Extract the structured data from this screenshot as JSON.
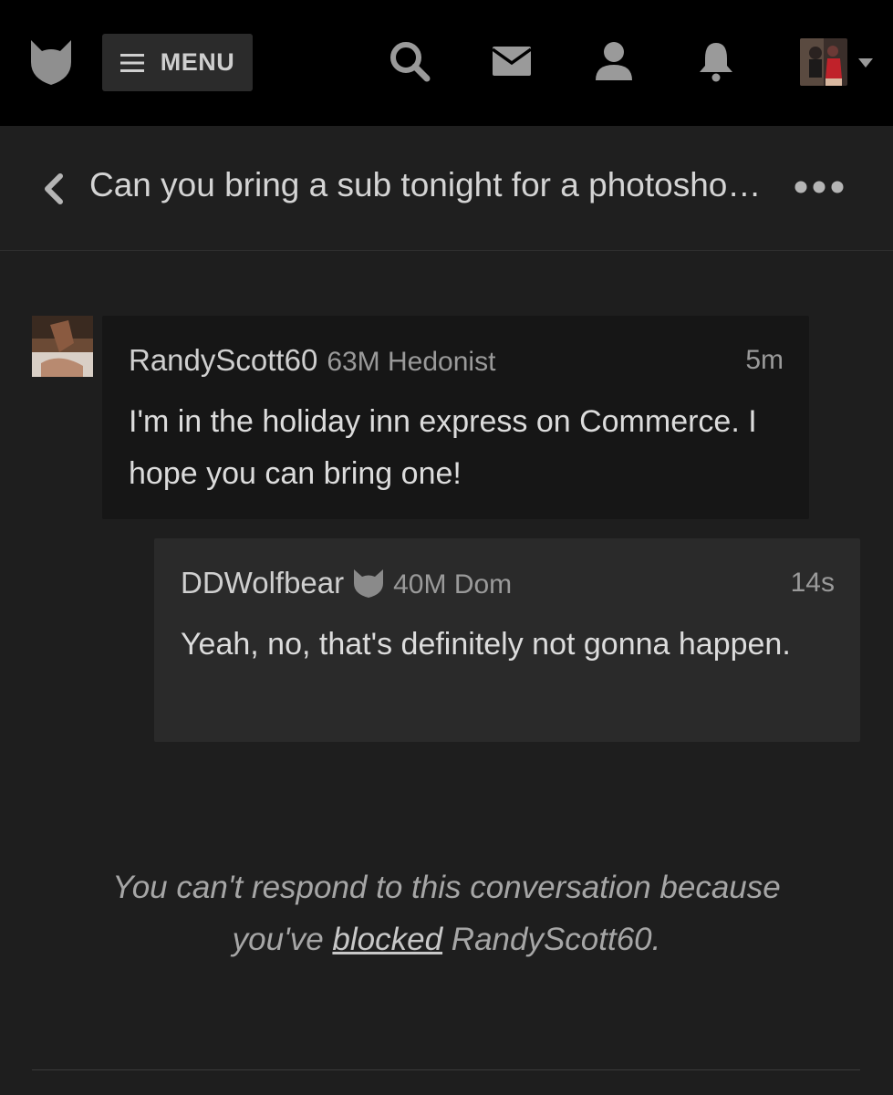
{
  "topbar": {
    "menu_label": "MENU",
    "icons": [
      "logo-icon",
      "hamburger-icon",
      "search-icon",
      "mail-icon",
      "user-icon",
      "bell-icon",
      "chevron-down-icon"
    ]
  },
  "conversation": {
    "title": "Can you bring a sub tonight for a photosho…"
  },
  "messages": [
    {
      "username": "RandyScott60",
      "details": "63M Hedonist",
      "time": "5m",
      "text": "I'm in the holiday inn express on Commerce. I hope you can bring one!"
    },
    {
      "username": "DDWolfbear",
      "details": "40M Dom",
      "time": "14s",
      "text": "Yeah, no, that's definitely not gonna happen."
    }
  ],
  "notice": {
    "line1": "You can't respond to this conversation because",
    "prefix": "you've ",
    "link": "blocked",
    "suffix": " RandyScott60."
  },
  "colors": {
    "topbar_bg": "#000000",
    "page_bg": "#1e1e1e",
    "bubble_received": "#161616",
    "bubble_sent": "#2a2a2a"
  }
}
